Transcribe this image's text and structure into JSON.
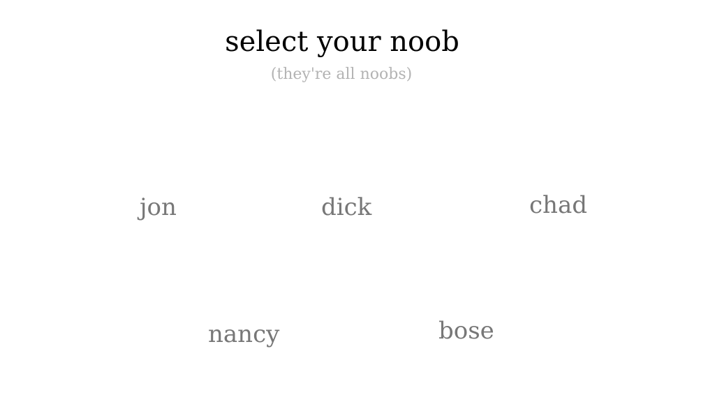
{
  "header": {
    "title": "select your noob",
    "subtitle": "(they're all noobs)"
  },
  "characters": [
    {
      "label": "jon"
    },
    {
      "label": "dick"
    },
    {
      "label": "chad"
    },
    {
      "label": "nancy"
    },
    {
      "label": "bose"
    }
  ],
  "colors": {
    "background": "#ffffff",
    "title": "#000000",
    "subtitle": "#b3b3b3",
    "character": "#777777"
  }
}
